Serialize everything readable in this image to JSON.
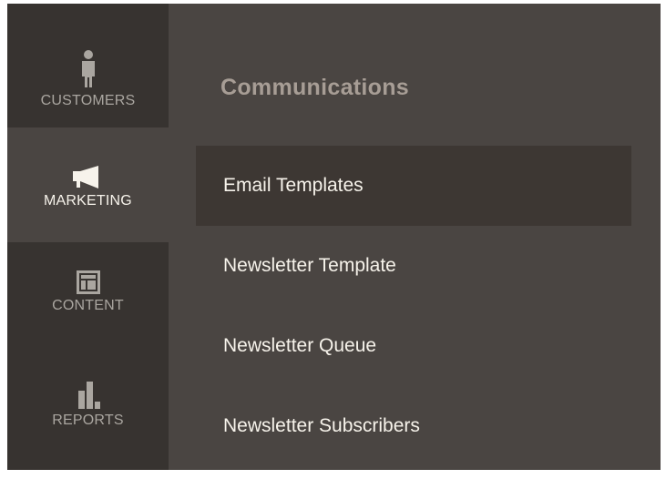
{
  "nav": {
    "items": [
      {
        "label": "CUSTOMERS",
        "icon": "customer-icon"
      },
      {
        "label": "MARKETING",
        "icon": "megaphone-icon",
        "active": true
      },
      {
        "label": "CONTENT",
        "icon": "layout-icon"
      },
      {
        "label": "REPORTS",
        "icon": "bar-chart-icon"
      }
    ]
  },
  "submenu": {
    "title": "Communications",
    "items": [
      {
        "label": "Email Templates",
        "active": true
      },
      {
        "label": "Newsletter Template"
      },
      {
        "label": "Newsletter Queue"
      },
      {
        "label": "Newsletter Subscribers"
      }
    ]
  },
  "colors": {
    "nav_bg": "#373330",
    "panel_bg": "#4a4542",
    "active_item_bg": "#3d3733",
    "title_text": "#a79d95",
    "item_text": "#f7f3eb",
    "nav_label_text": "#aaa6a0"
  }
}
